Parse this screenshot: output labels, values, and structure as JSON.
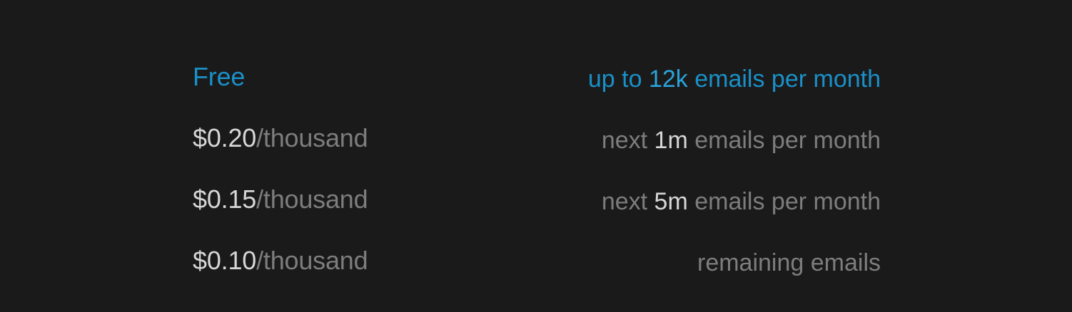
{
  "colors": {
    "background": "#1a1a1a",
    "accent": "#1a90c8",
    "primary_text": "#d6d6d6",
    "muted_text": "#7d7d7d"
  },
  "pricing": {
    "tiers": [
      {
        "price_amount": "Free",
        "price_unit": "",
        "desc_prefix": "up to ",
        "desc_number": "12k",
        "desc_suffix": " emails per month"
      },
      {
        "price_amount": "$0.20",
        "price_unit": "/thousand",
        "desc_prefix": "next ",
        "desc_number": "1m",
        "desc_suffix": " emails per month"
      },
      {
        "price_amount": "$0.15",
        "price_unit": "/thousand",
        "desc_prefix": "next ",
        "desc_number": "5m",
        "desc_suffix": " emails per month"
      },
      {
        "price_amount": "$0.10",
        "price_unit": "/thousand",
        "desc_prefix": "",
        "desc_number": "",
        "desc_suffix": "remaining emails"
      }
    ]
  }
}
